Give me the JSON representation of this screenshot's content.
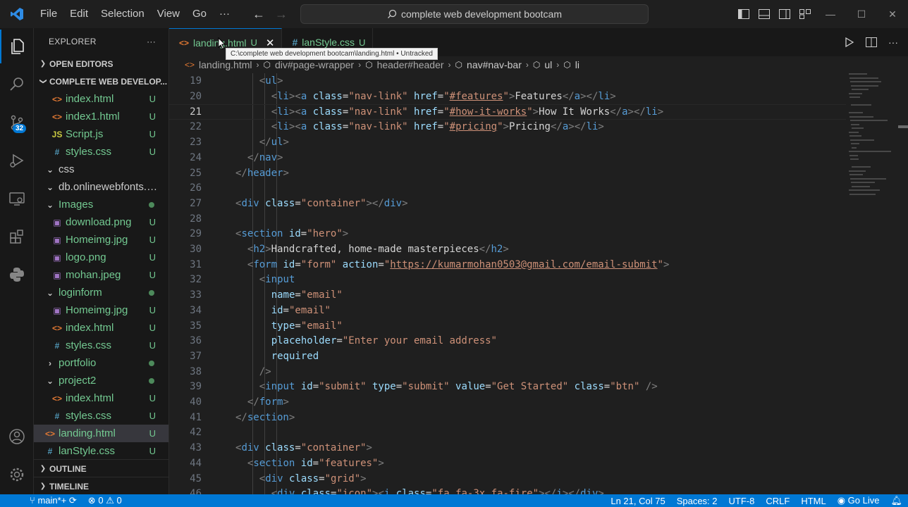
{
  "menu": {
    "items": [
      "File",
      "Edit",
      "Selection",
      "View",
      "Go",
      "···"
    ]
  },
  "command_center": {
    "text": "complete web development bootcam"
  },
  "sidebar": {
    "title": "EXPLORER",
    "more": "···",
    "open_editors": "OPEN EDITORS",
    "workspace": "COMPLETE WEB DEVELOP...",
    "tree": [
      {
        "label": "index.html",
        "icon": "<>",
        "kind": "html",
        "status": "U"
      },
      {
        "label": "index1.html",
        "icon": "<>",
        "kind": "html",
        "status": "U"
      },
      {
        "label": "Script.js",
        "icon": "JS",
        "kind": "js",
        "status": "U"
      },
      {
        "label": "styles.css",
        "icon": "#",
        "kind": "css",
        "status": "U"
      },
      {
        "label": "css",
        "icon": "⌄",
        "kind": "folder",
        "status": ""
      },
      {
        "label": "db.onlinewebfonts.co...",
        "icon": "⌄",
        "kind": "folder",
        "status": ""
      },
      {
        "label": "Images",
        "icon": "⌄",
        "kind": "folder-mod",
        "status": ""
      },
      {
        "label": "download.png",
        "icon": "▣",
        "kind": "img",
        "status": "U"
      },
      {
        "label": "Homeimg.jpg",
        "icon": "▣",
        "kind": "img",
        "status": "U"
      },
      {
        "label": "logo.png",
        "icon": "▣",
        "kind": "img",
        "status": "U"
      },
      {
        "label": "mohan.jpeg",
        "icon": "▣",
        "kind": "img",
        "status": "U"
      },
      {
        "label": "loginform",
        "icon": "⌄",
        "kind": "folder-mod",
        "status": ""
      },
      {
        "label": "Homeimg.jpg",
        "icon": "▣",
        "kind": "img",
        "status": "U"
      },
      {
        "label": "index.html",
        "icon": "<>",
        "kind": "html",
        "status": "U"
      },
      {
        "label": "styles.css",
        "icon": "#",
        "kind": "css",
        "status": "U"
      },
      {
        "label": "portfolio",
        "icon": "›",
        "kind": "folder-mod",
        "status": ""
      },
      {
        "label": "project2",
        "icon": "⌄",
        "kind": "folder-mod",
        "status": ""
      },
      {
        "label": "index.html",
        "icon": "<>",
        "kind": "html",
        "status": "U"
      },
      {
        "label": "styles.css",
        "icon": "#",
        "kind": "css",
        "status": "U"
      },
      {
        "label": "landing.html",
        "icon": "<>",
        "kind": "html",
        "status": "U"
      },
      {
        "label": "lanStyle.css",
        "icon": "#",
        "kind": "css",
        "status": "U"
      }
    ],
    "outline": "OUTLINE",
    "timeline": "TIMELINE"
  },
  "activity": {
    "scm_badge": "32"
  },
  "tabs": [
    {
      "label": "landing.html",
      "status": "U",
      "icon": "<>",
      "close": "✕"
    },
    {
      "label": "lanStyle.css",
      "status": "U",
      "icon": "#"
    }
  ],
  "tooltip": "C:\\complete web development bootcam\\landing.html • Untracked",
  "breadcrumb": [
    "landing.html",
    "div#page-wrapper",
    "header#header",
    "nav#nav-bar",
    "ul",
    "li"
  ],
  "code": {
    "current_line": 21,
    "lines": [
      {
        "n": "19",
        "indent": 2,
        "tokens": [
          [
            "p",
            "<"
          ],
          [
            "t",
            "ul"
          ],
          [
            "p",
            ">"
          ]
        ]
      },
      {
        "n": "20",
        "indent": 3,
        "tokens": [
          [
            "p",
            "<"
          ],
          [
            "t",
            "li"
          ],
          [
            "p",
            "><"
          ],
          [
            "t",
            "a"
          ],
          [
            "x",
            " "
          ],
          [
            "a",
            "class"
          ],
          [
            "x",
            "="
          ],
          [
            "s",
            "\"nav-link\""
          ],
          [
            "x",
            " "
          ],
          [
            "a",
            "href"
          ],
          [
            "x",
            "="
          ],
          [
            "s",
            "\""
          ],
          [
            "l",
            "#features"
          ],
          [
            "s",
            "\""
          ],
          [
            "p",
            ">"
          ],
          [
            "x",
            "Features"
          ],
          [
            "p",
            "</"
          ],
          [
            "t",
            "a"
          ],
          [
            "p",
            "></"
          ],
          [
            "t",
            "li"
          ],
          [
            "p",
            ">"
          ]
        ]
      },
      {
        "n": "21",
        "indent": 3,
        "tokens": [
          [
            "p",
            "<"
          ],
          [
            "t",
            "li"
          ],
          [
            "p",
            "><"
          ],
          [
            "t",
            "a"
          ],
          [
            "x",
            " "
          ],
          [
            "a",
            "class"
          ],
          [
            "x",
            "="
          ],
          [
            "s",
            "\"nav-link\""
          ],
          [
            "x",
            " "
          ],
          [
            "a",
            "href"
          ],
          [
            "x",
            "="
          ],
          [
            "s",
            "\""
          ],
          [
            "l",
            "#how-it-works"
          ],
          [
            "s",
            "\""
          ],
          [
            "p",
            ">"
          ],
          [
            "x",
            "How It Works"
          ],
          [
            "p",
            "</"
          ],
          [
            "t",
            "a"
          ],
          [
            "p",
            "></"
          ],
          [
            "t",
            "li"
          ],
          [
            "p",
            ">"
          ]
        ]
      },
      {
        "n": "22",
        "indent": 3,
        "tokens": [
          [
            "p",
            "<"
          ],
          [
            "t",
            "li"
          ],
          [
            "p",
            "><"
          ],
          [
            "t",
            "a"
          ],
          [
            "x",
            " "
          ],
          [
            "a",
            "class"
          ],
          [
            "x",
            "="
          ],
          [
            "s",
            "\"nav-link\""
          ],
          [
            "x",
            " "
          ],
          [
            "a",
            "href"
          ],
          [
            "x",
            "="
          ],
          [
            "s",
            "\""
          ],
          [
            "l",
            "#pricing"
          ],
          [
            "s",
            "\""
          ],
          [
            "p",
            ">"
          ],
          [
            "x",
            "Pricing"
          ],
          [
            "p",
            "</"
          ],
          [
            "t",
            "a"
          ],
          [
            "p",
            "></"
          ],
          [
            "t",
            "li"
          ],
          [
            "p",
            ">"
          ]
        ]
      },
      {
        "n": "23",
        "indent": 2,
        "tokens": [
          [
            "p",
            "</"
          ],
          [
            "t",
            "ul"
          ],
          [
            "p",
            ">"
          ]
        ]
      },
      {
        "n": "24",
        "indent": 1,
        "tokens": [
          [
            "p",
            "</"
          ],
          [
            "t",
            "nav"
          ],
          [
            "p",
            ">"
          ]
        ]
      },
      {
        "n": "25",
        "indent": 0,
        "tokens": [
          [
            "p",
            "</"
          ],
          [
            "t",
            "header"
          ],
          [
            "p",
            ">"
          ]
        ]
      },
      {
        "n": "26",
        "indent": 0,
        "tokens": []
      },
      {
        "n": "27",
        "indent": 0,
        "tokens": [
          [
            "p",
            "<"
          ],
          [
            "t",
            "div"
          ],
          [
            "x",
            " "
          ],
          [
            "a",
            "class"
          ],
          [
            "x",
            "="
          ],
          [
            "s",
            "\"container\""
          ],
          [
            "p",
            "></"
          ],
          [
            "t",
            "div"
          ],
          [
            "p",
            ">"
          ]
        ]
      },
      {
        "n": "28",
        "indent": 0,
        "tokens": []
      },
      {
        "n": "29",
        "indent": 0,
        "tokens": [
          [
            "p",
            "<"
          ],
          [
            "t",
            "section"
          ],
          [
            "x",
            " "
          ],
          [
            "a",
            "id"
          ],
          [
            "x",
            "="
          ],
          [
            "s",
            "\"hero\""
          ],
          [
            "p",
            ">"
          ]
        ]
      },
      {
        "n": "30",
        "indent": 1,
        "tokens": [
          [
            "p",
            "<"
          ],
          [
            "t",
            "h2"
          ],
          [
            "p",
            ">"
          ],
          [
            "x",
            "Handcrafted, home-made masterpieces"
          ],
          [
            "p",
            "</"
          ],
          [
            "t",
            "h2"
          ],
          [
            "p",
            ">"
          ]
        ]
      },
      {
        "n": "31",
        "indent": 1,
        "tokens": [
          [
            "p",
            "<"
          ],
          [
            "t",
            "form"
          ],
          [
            "x",
            " "
          ],
          [
            "a",
            "id"
          ],
          [
            "x",
            "="
          ],
          [
            "s",
            "\"form\""
          ],
          [
            "x",
            " "
          ],
          [
            "a",
            "action"
          ],
          [
            "x",
            "="
          ],
          [
            "s",
            "\""
          ],
          [
            "l",
            "https://kumarmohan0503@gmail.com/email-submit"
          ],
          [
            "s",
            "\""
          ],
          [
            "p",
            ">"
          ]
        ]
      },
      {
        "n": "32",
        "indent": 2,
        "tokens": [
          [
            "p",
            "<"
          ],
          [
            "t",
            "input"
          ]
        ]
      },
      {
        "n": "33",
        "indent": 3,
        "tokens": [
          [
            "a",
            "name"
          ],
          [
            "x",
            "="
          ],
          [
            "s",
            "\"email\""
          ]
        ]
      },
      {
        "n": "34",
        "indent": 3,
        "tokens": [
          [
            "a",
            "id"
          ],
          [
            "x",
            "="
          ],
          [
            "s",
            "\"email\""
          ]
        ]
      },
      {
        "n": "35",
        "indent": 3,
        "tokens": [
          [
            "a",
            "type"
          ],
          [
            "x",
            "="
          ],
          [
            "s",
            "\"email\""
          ]
        ]
      },
      {
        "n": "36",
        "indent": 3,
        "tokens": [
          [
            "a",
            "placeholder"
          ],
          [
            "x",
            "="
          ],
          [
            "s",
            "\"Enter your email address\""
          ]
        ]
      },
      {
        "n": "37",
        "indent": 3,
        "tokens": [
          [
            "a",
            "required"
          ]
        ]
      },
      {
        "n": "38",
        "indent": 2,
        "tokens": [
          [
            "p",
            "/>"
          ]
        ]
      },
      {
        "n": "39",
        "indent": 2,
        "tokens": [
          [
            "p",
            "<"
          ],
          [
            "t",
            "input"
          ],
          [
            "x",
            " "
          ],
          [
            "a",
            "id"
          ],
          [
            "x",
            "="
          ],
          [
            "s",
            "\"submit\""
          ],
          [
            "x",
            " "
          ],
          [
            "a",
            "type"
          ],
          [
            "x",
            "="
          ],
          [
            "s",
            "\"submit\""
          ],
          [
            "x",
            " "
          ],
          [
            "a",
            "value"
          ],
          [
            "x",
            "="
          ],
          [
            "s",
            "\"Get Started\""
          ],
          [
            "x",
            " "
          ],
          [
            "a",
            "class"
          ],
          [
            "x",
            "="
          ],
          [
            "s",
            "\"btn\""
          ],
          [
            "x",
            " "
          ],
          [
            "p",
            "/>"
          ]
        ]
      },
      {
        "n": "40",
        "indent": 1,
        "tokens": [
          [
            "p",
            "</"
          ],
          [
            "t",
            "form"
          ],
          [
            "p",
            ">"
          ]
        ]
      },
      {
        "n": "41",
        "indent": 0,
        "tokens": [
          [
            "p",
            "</"
          ],
          [
            "t",
            "section"
          ],
          [
            "p",
            ">"
          ]
        ]
      },
      {
        "n": "42",
        "indent": 0,
        "tokens": []
      },
      {
        "n": "43",
        "indent": 0,
        "tokens": [
          [
            "p",
            "<"
          ],
          [
            "t",
            "div"
          ],
          [
            "x",
            " "
          ],
          [
            "a",
            "class"
          ],
          [
            "x",
            "="
          ],
          [
            "s",
            "\"container\""
          ],
          [
            "p",
            ">"
          ]
        ]
      },
      {
        "n": "44",
        "indent": 1,
        "tokens": [
          [
            "p",
            "<"
          ],
          [
            "t",
            "section"
          ],
          [
            "x",
            " "
          ],
          [
            "a",
            "id"
          ],
          [
            "x",
            "="
          ],
          [
            "s",
            "\"features\""
          ],
          [
            "p",
            ">"
          ]
        ]
      },
      {
        "n": "45",
        "indent": 2,
        "tokens": [
          [
            "p",
            "<"
          ],
          [
            "t",
            "div"
          ],
          [
            "x",
            " "
          ],
          [
            "a",
            "class"
          ],
          [
            "x",
            "="
          ],
          [
            "s",
            "\"grid\""
          ],
          [
            "p",
            ">"
          ]
        ]
      },
      {
        "n": "46",
        "indent": 3,
        "tokens": [
          [
            "p",
            "<"
          ],
          [
            "t",
            "div"
          ],
          [
            "x",
            " "
          ],
          [
            "a",
            "class"
          ],
          [
            "x",
            "="
          ],
          [
            "s",
            "\"icon\""
          ],
          [
            "p",
            "><"
          ],
          [
            "t",
            "i"
          ],
          [
            "x",
            " "
          ],
          [
            "a",
            "class"
          ],
          [
            "x",
            "="
          ],
          [
            "s",
            "\"fa fa-3x fa-fire\""
          ],
          [
            "p",
            "></"
          ],
          [
            "t",
            "i"
          ],
          [
            "p",
            "></"
          ],
          [
            "t",
            "div"
          ],
          [
            "p",
            ">"
          ]
        ]
      }
    ]
  },
  "status": {
    "branch": "main*+",
    "errors": "0",
    "warnings": "0",
    "position": "Ln 21, Col 75",
    "spaces": "Spaces: 2",
    "encoding": "UTF-8",
    "eol": "CRLF",
    "language": "HTML",
    "golive": "Go Live"
  },
  "colors": {
    "accent": "#0078d4",
    "untracked": "#73c991"
  }
}
